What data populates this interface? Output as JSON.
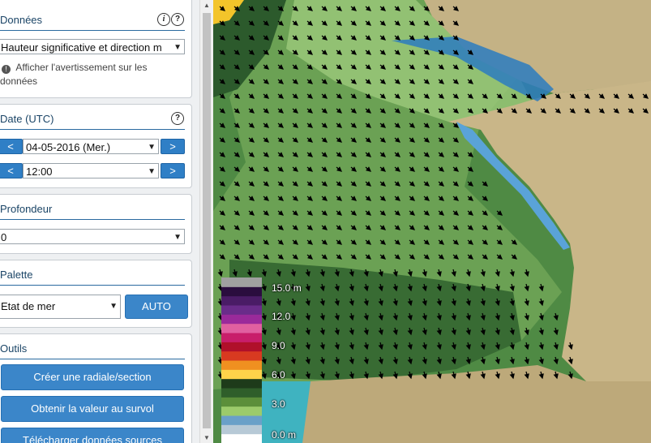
{
  "donnees": {
    "title": "Données",
    "info_icon": "info-icon",
    "help_icon": "help-icon",
    "select_value": "Hauteur significative et direction m",
    "warning_label": "Afficher l'avertissement sur les données"
  },
  "date": {
    "title": "Date (UTC)",
    "help_icon": "help-icon",
    "prev": "<",
    "next": ">",
    "day_value": "04-05-2016 (Mer.)",
    "time_value": "12:00"
  },
  "profondeur": {
    "title": "Profondeur",
    "value": "0"
  },
  "palette": {
    "title": "Palette",
    "value": "Etat de mer",
    "auto_button": "AUTO"
  },
  "outils": {
    "title": "Outils",
    "buttons": [
      "Créer une radiale/section",
      "Obtenir la valeur au survol",
      "Télécharger données sources"
    ]
  },
  "legend": {
    "labels": [
      "15.0 m",
      "12.0",
      "9.0",
      "6.0",
      "3.0",
      "0.0 m"
    ],
    "colors": [
      "#ffffff",
      "#b7c9d6",
      "#6aa0c8",
      "#9ccb6b",
      "#5c8f3a",
      "#2f5e2a",
      "#1e3b1a",
      "#ffd24a",
      "#f09020",
      "#d83a20",
      "#b0102a",
      "#c81e6a",
      "#e060a0",
      "#9a2a9a",
      "#6a2c8a",
      "#4a1c66",
      "#2a0d3e",
      "#a0a0a0"
    ]
  }
}
